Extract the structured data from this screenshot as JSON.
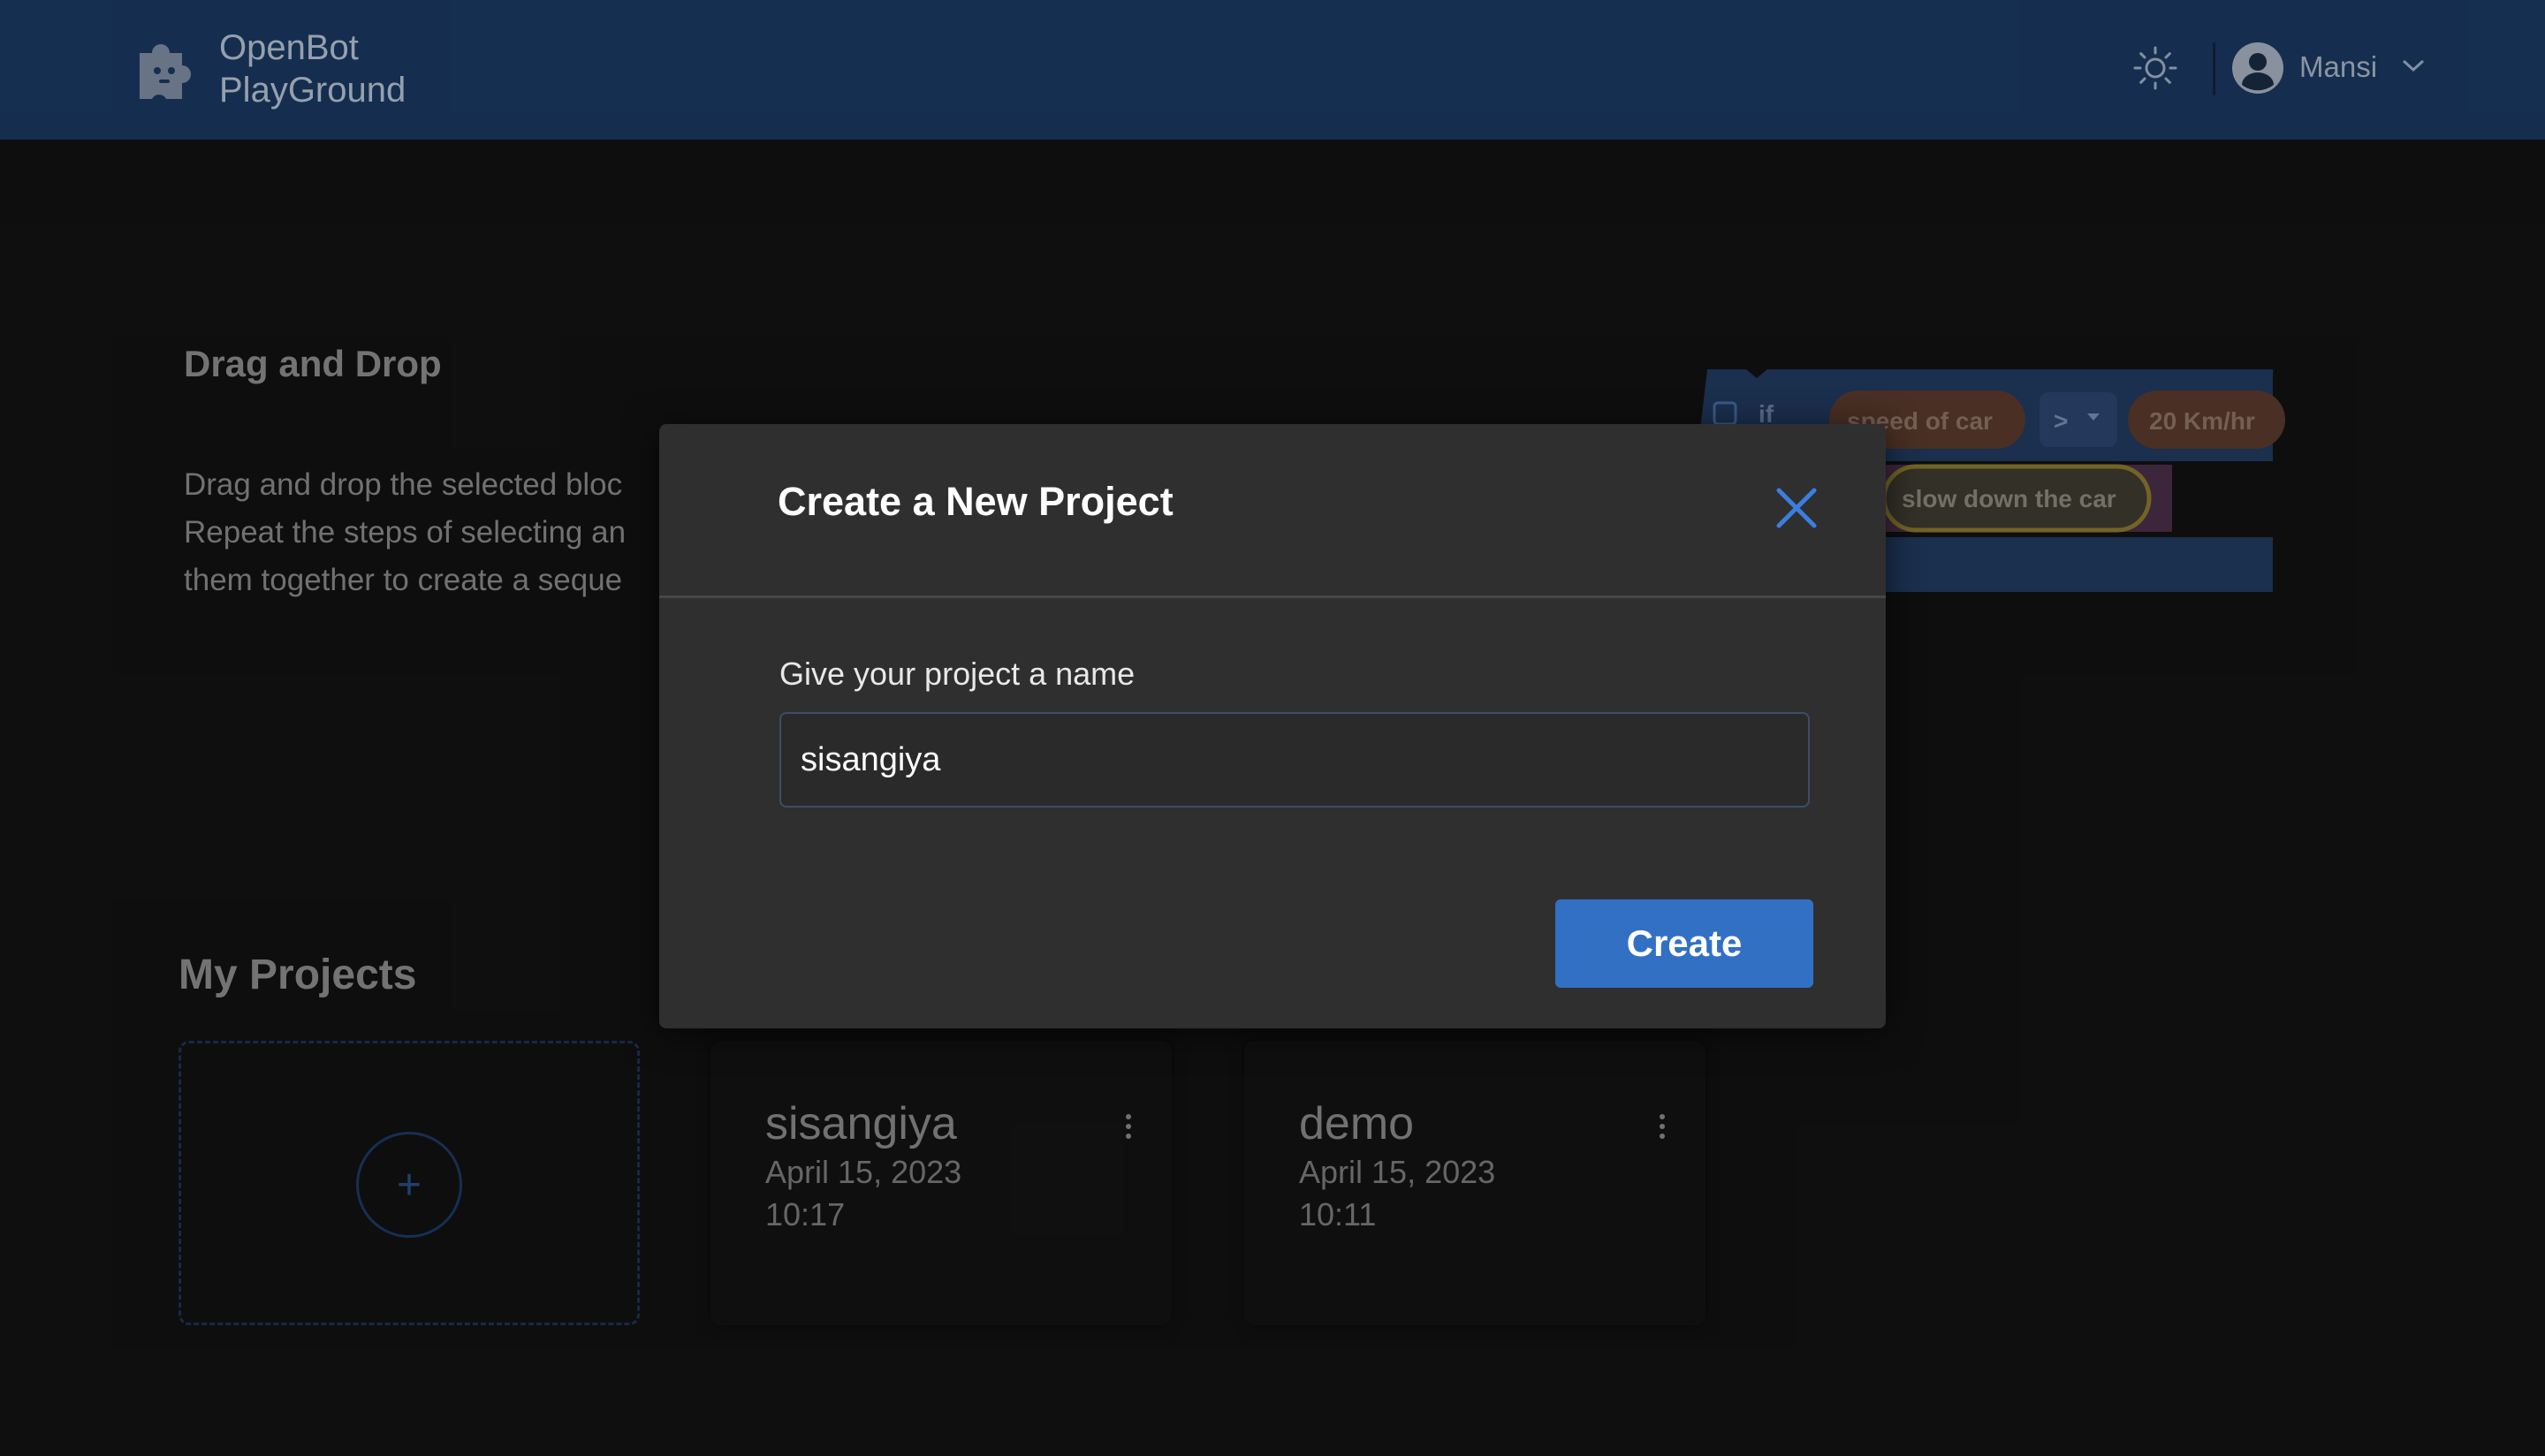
{
  "header": {
    "app_name_line1": "OpenBot",
    "app_name_line2": "PlayGround",
    "user_name": "Mansi",
    "icons": [
      "puzzle-logo-icon",
      "sun-icon",
      "user-avatar-icon",
      "chevron-down-icon"
    ]
  },
  "intro": {
    "title": "Drag and Drop",
    "description_lines": [
      "Drag and drop the selected bloc",
      "Repeat the steps of selecting an",
      "them together to create a seque"
    ]
  },
  "blocks": {
    "if_label": "if",
    "condition_left": "speed of car",
    "operator": ">",
    "condition_right": "20 Km/hr",
    "action": "slow down the car"
  },
  "projects": {
    "title": "My Projects",
    "new_symbol": "+",
    "items": [
      {
        "name": "sisangiya",
        "date": "April 15, 2023",
        "time": "10:17"
      },
      {
        "name": "demo",
        "date": "April 15, 2023",
        "time": "10:11"
      }
    ]
  },
  "modal": {
    "title": "Create a New Project",
    "field_label": "Give your project a name",
    "input_value": "sisangiya",
    "create_label": "Create"
  },
  "colors": {
    "header_bg": "#1a3961",
    "page_bg": "#121212",
    "modal_bg": "#2f2f2f",
    "accent": "#3270c4",
    "block_blue": "#2e4a78",
    "block_pill": "#7a4b35",
    "block_action_outline": "#c9a227"
  }
}
